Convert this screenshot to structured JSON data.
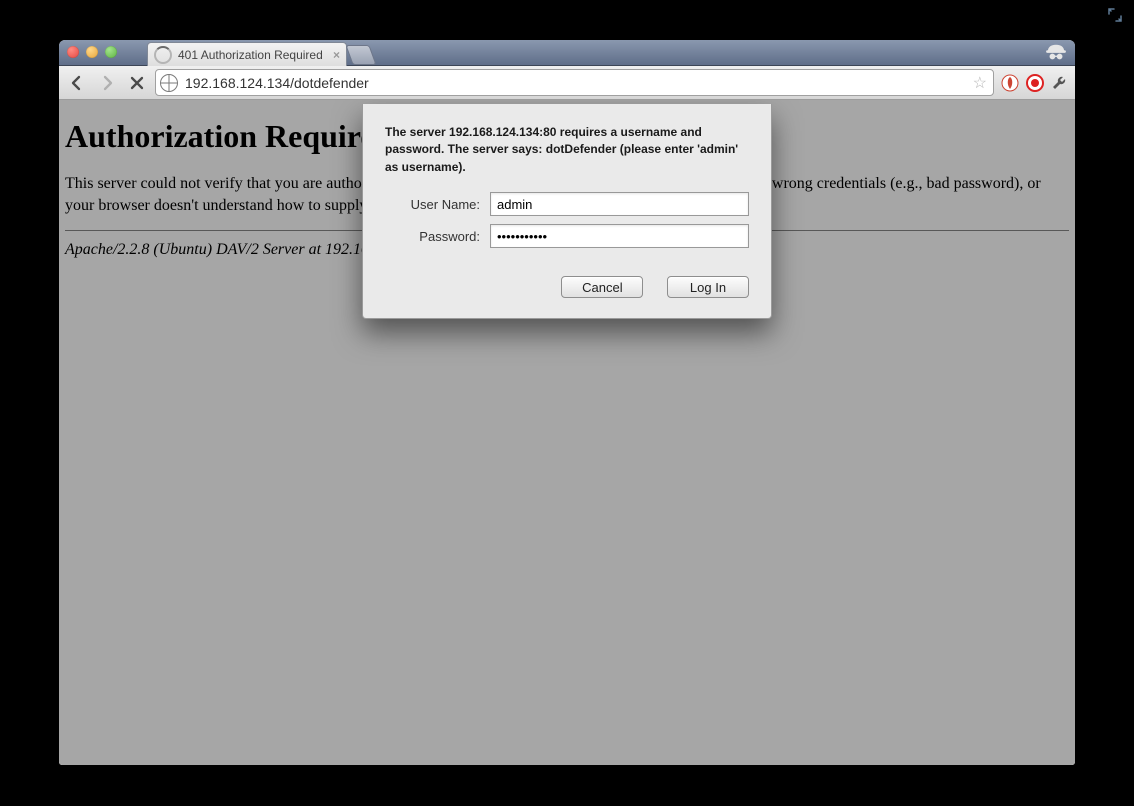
{
  "tab": {
    "title": "401 Authorization Required"
  },
  "address_bar": {
    "url": "192.168.124.134/dotdefender"
  },
  "page": {
    "heading": "Authorization Required",
    "body": "This server could not verify that you are authorized to access the document requested. Either you supplied the wrong credentials (e.g., bad password), or your browser doesn't understand how to supply the credentials required.",
    "signature": "Apache/2.2.8 (Ubuntu) DAV/2 Server at 192.168.124.134 Port 80"
  },
  "dialog": {
    "message": "The server 192.168.124.134:80 requires a username and password. The server says: dotDefender (please enter 'admin' as username).",
    "username_label": "User Name:",
    "username_value": "admin",
    "password_label": "Password:",
    "password_value": "•••••••••••",
    "cancel_label": "Cancel",
    "login_label": "Log In"
  }
}
